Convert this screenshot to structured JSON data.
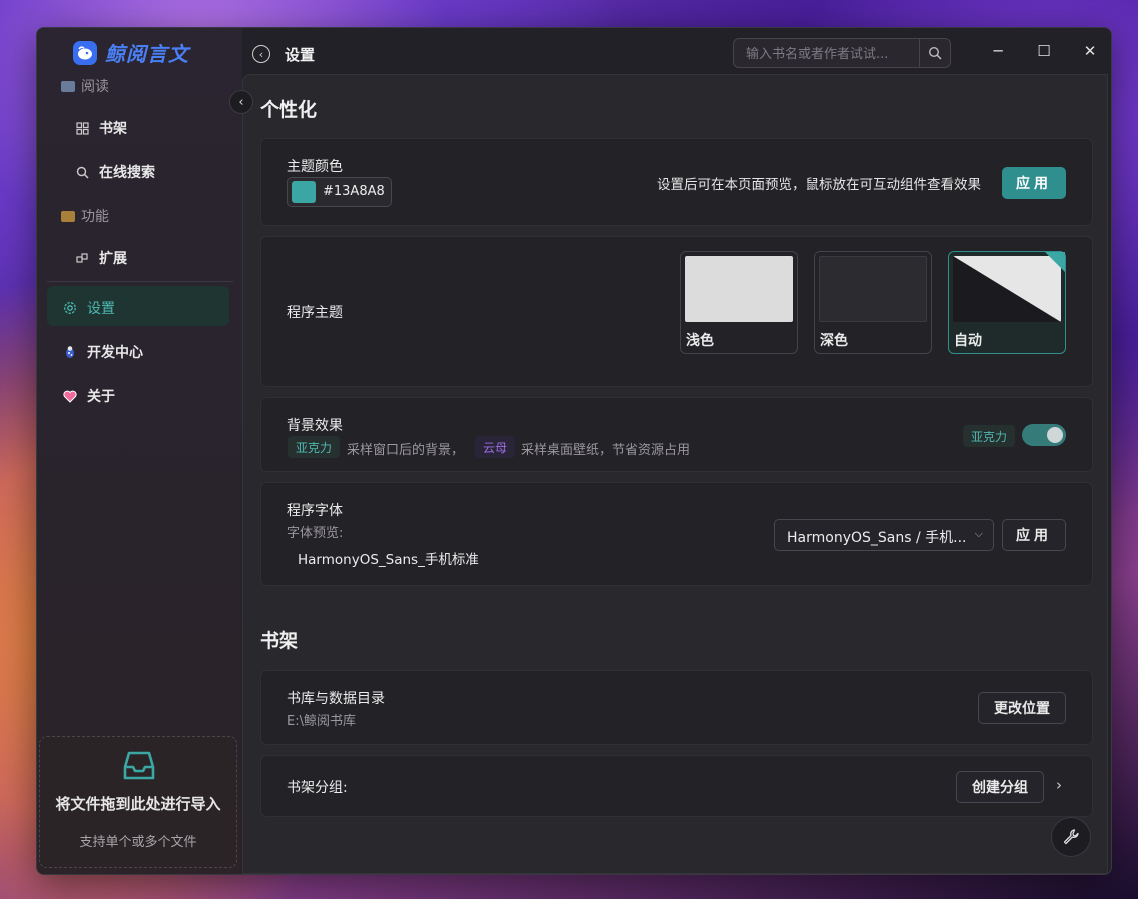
{
  "app": {
    "name": "鲸阅言文"
  },
  "sidebar": {
    "groups": [
      {
        "label": "阅读"
      },
      {
        "label": "功能"
      }
    ],
    "items": [
      {
        "label": "书架",
        "icon": "bookshelf-icon"
      },
      {
        "label": "在线搜索",
        "icon": "search-icon"
      },
      {
        "label": "扩展",
        "icon": "extension-icon"
      },
      {
        "label": "设置",
        "icon": "gear-icon"
      },
      {
        "label": "开发中心",
        "icon": "bug-icon"
      },
      {
        "label": "关于",
        "icon": "heart-icon"
      }
    ],
    "drop": {
      "title": "将文件拖到此处进行导入",
      "hint": "支持单个或多个文件"
    }
  },
  "titlebar": {
    "title": "设置",
    "search_placeholder": "输入书名或者作者试试...",
    "minimize": "─",
    "maximize": "☐",
    "close": "✕"
  },
  "personalization": {
    "heading": "个性化",
    "theme_color": {
      "label": "主题颜色",
      "value": "#13A8A8",
      "hint": "设置后可在本页面预览，鼠标放在可互动组件查看效果",
      "apply": "应用"
    },
    "program_theme": {
      "label": "程序主题",
      "options": [
        {
          "label": "浅色"
        },
        {
          "label": "深色"
        },
        {
          "label": "自动"
        }
      ],
      "selected": "自动"
    },
    "background": {
      "label": "背景效果",
      "tag_acrylic": "亚克力",
      "text_acrylic": "采样窗口后的背景，",
      "tag_mica": "云母",
      "text_mica": "采样桌面壁纸，节省资源占用",
      "current": "亚克力",
      "enabled": true
    },
    "font": {
      "label": "程序字体",
      "preview_label": "字体预览:",
      "preview_text": "HarmonyOS_Sans_手机标准",
      "selected": "HarmonyOS_Sans / 手机...",
      "apply": "应用"
    }
  },
  "bookshelf": {
    "heading": "书架",
    "library": {
      "label": "书库与数据目录",
      "path": "E:\\鲸阅书库",
      "button": "更改位置"
    },
    "groups": {
      "label": "书架分组:",
      "button": "创建分组"
    }
  },
  "colors": {
    "accent": "#13A8A8",
    "accent_button": "#2f8f8f",
    "background": "#29282d"
  }
}
